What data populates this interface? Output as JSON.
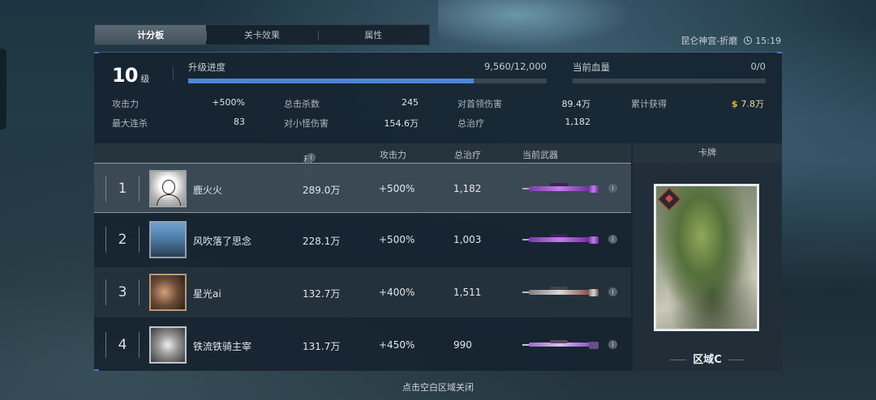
{
  "tabs": [
    {
      "label": "计分板",
      "active": true
    },
    {
      "label": "关卡效果",
      "active": false
    },
    {
      "label": "属性",
      "active": false
    }
  ],
  "location": "昆仑神宫-折磨",
  "time": "15:19",
  "level": {
    "value": "10",
    "unit": "级"
  },
  "upgrade": {
    "label": "升级进度",
    "value": "9,560/12,000",
    "progress": 0.797
  },
  "health": {
    "label": "当前血量",
    "value": "0/0",
    "progress": 0
  },
  "stats": {
    "attack": {
      "label": "攻击力",
      "value": "+500%"
    },
    "max_streak": {
      "label": "最大连杀",
      "value": "83"
    },
    "total_kills": {
      "label": "总击杀数",
      "value": "245"
    },
    "minion_damage": {
      "label": "对小怪伤害",
      "value": "154.6万"
    },
    "boss_damage": {
      "label": "对首领伤害",
      "value": "89.4万"
    },
    "total_heal": {
      "label": "总治疗",
      "value": "1,182"
    },
    "earned": {
      "label": "累计获得",
      "value": "7.8万",
      "currency_icon": "$"
    }
  },
  "table": {
    "headers": {
      "score": "积分",
      "info_icon": "i",
      "attack": "攻击力",
      "heal": "总治疗",
      "weapon": "当前武器"
    },
    "rows": [
      {
        "rank": "1",
        "name": "鹿火火",
        "score": "289.0万",
        "attack": "+500%",
        "heal": "1,182",
        "weapon_icon": "purple-sniper-rifle"
      },
      {
        "rank": "2",
        "name": "风吹落了思念",
        "score": "228.1万",
        "attack": "+500%",
        "heal": "1,003",
        "weapon_icon": "purple-sniper-rifle"
      },
      {
        "rank": "3",
        "name": "星光ai",
        "score": "132.7万",
        "attack": "+400%",
        "heal": "1,511",
        "weapon_icon": "grey-sniper-rifle"
      },
      {
        "rank": "4",
        "name": "铁流铁骑主宰",
        "score": "131.7万",
        "attack": "+450%",
        "heal": "990",
        "weapon_icon": "purple-assault-rifle"
      }
    ],
    "row_info_icon": "i"
  },
  "card": {
    "header": "卡牌",
    "label": "区域C"
  },
  "bottom_hint": "点击空白区域关闭",
  "colors": {
    "accent": "#4d86d8",
    "gold": "#e5b53a"
  }
}
